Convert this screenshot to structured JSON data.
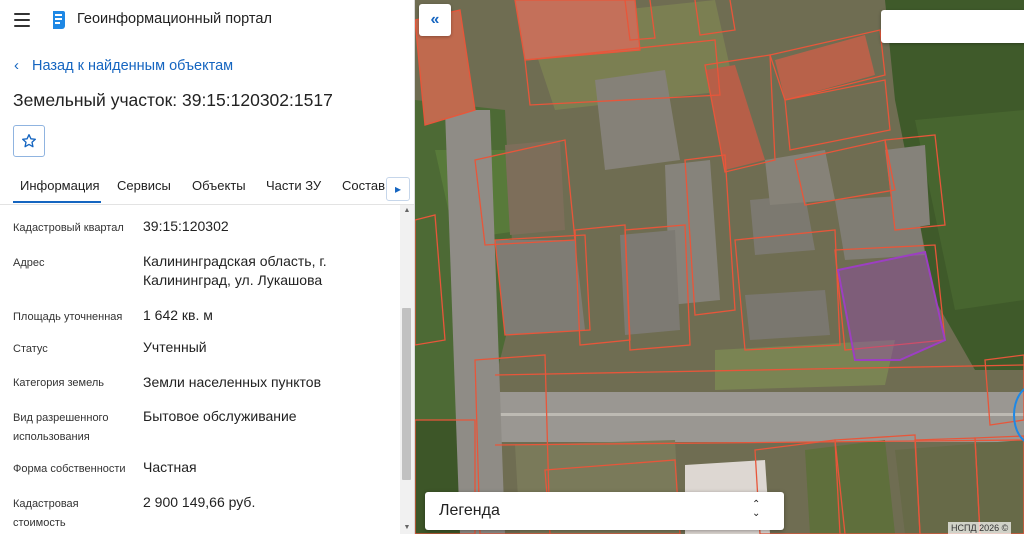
{
  "app": {
    "title": "Геоинформационный портал"
  },
  "nav": {
    "back_label": "Назад к найденным объектам"
  },
  "object": {
    "title": "Земельный участок: 39:15:120302:1517"
  },
  "tabs": [
    {
      "label": "Информация",
      "active": true
    },
    {
      "label": "Сервисы",
      "active": false
    },
    {
      "label": "Объекты",
      "active": false
    },
    {
      "label": "Части ЗУ",
      "active": false
    },
    {
      "label": "Состав",
      "active": false
    }
  ],
  "properties": [
    {
      "label": "Кадастровый квартал",
      "value": "39:15:120302"
    },
    {
      "label": "Адрес",
      "value": "Калининградская область, г. Калининград, ул. Лукашова"
    },
    {
      "label": "Площадь уточненная",
      "value": "1 642 кв. м"
    },
    {
      "label": "Статус",
      "value": "Учтенный"
    },
    {
      "label": "Категория земель",
      "value": "Земли населенных пунктов"
    },
    {
      "label": "Вид разрешенного использования",
      "value": "Бытовое обслуживание"
    },
    {
      "label": "Форма собственности",
      "value": "Частная"
    },
    {
      "label": "Кадастровая стоимость",
      "value": "2 900 149,66 руб."
    }
  ],
  "map": {
    "legend_label": "Легенда",
    "attribution": "НСПД 2026 ©",
    "search_placeholder": "",
    "colors": {
      "parcel_border": "#e8563a",
      "selected_parcel": "#9c3fc2",
      "accent": "#1565c0"
    }
  },
  "icons": {
    "menu": "hamburger-icon",
    "logo": "portal-logo-icon",
    "back": "chevron-left-icon",
    "favorite": "star-outline-icon",
    "tabs_next": "chevron-right-icon",
    "collapse": "double-chevron-left-icon",
    "legend_toggle": "chevron-up-down-icon"
  }
}
